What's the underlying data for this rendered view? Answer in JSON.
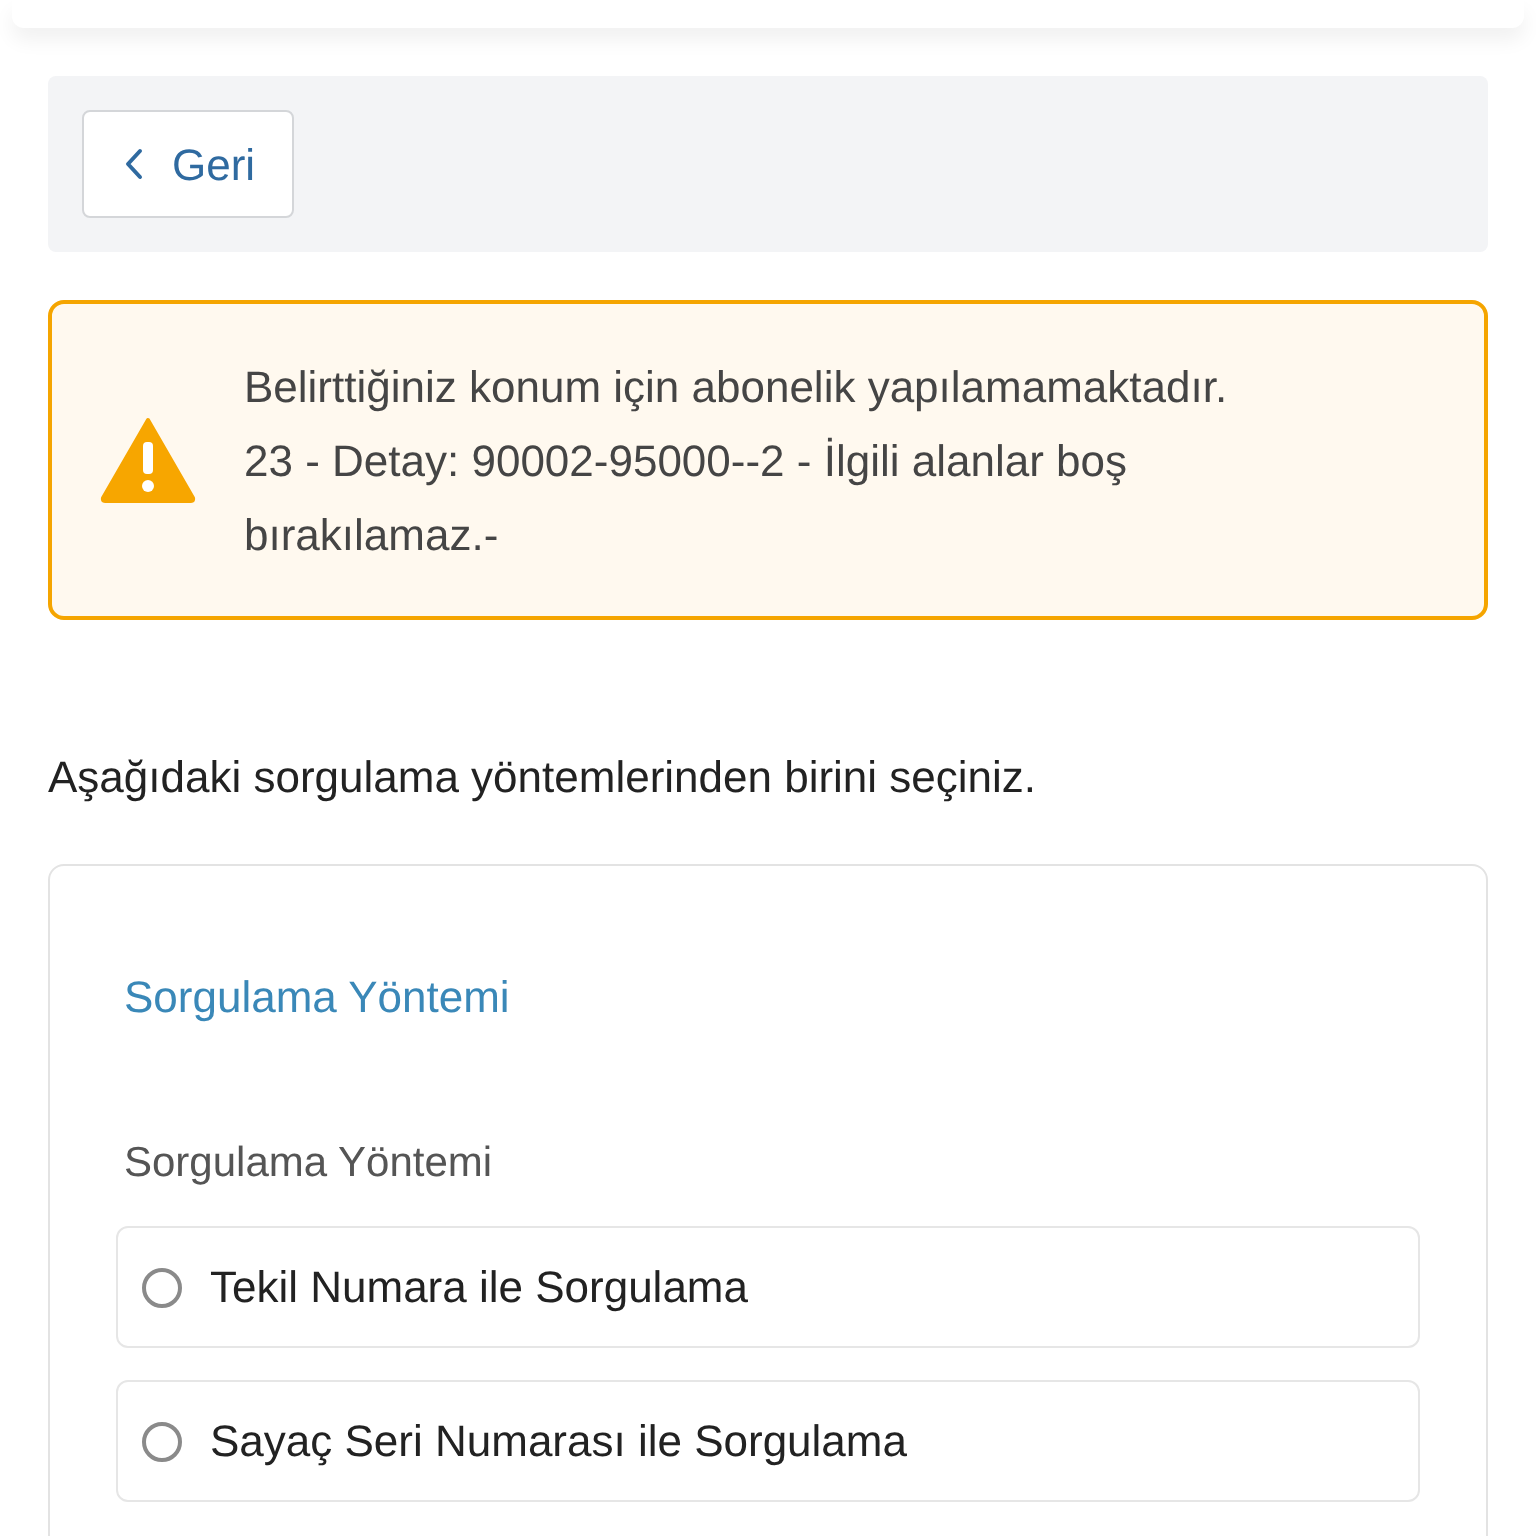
{
  "back_button": {
    "label": "Geri"
  },
  "alert": {
    "kind": "warning",
    "message": "Belirttiğiniz konum için abonelik yapılamamaktadır.",
    "detail": "23 - Detay: 90002-95000--2 - İlgili alanlar boş bırakılamaz.-"
  },
  "instruction": "Aşağıdaki sorgulama yöntemlerinden birini seçiniz.",
  "card": {
    "title": "Sorgulama Yöntemi",
    "field_label": "Sorgulama Yöntemi",
    "options": [
      {
        "label": "Tekil Numara ile Sorgulama",
        "selected": false
      },
      {
        "label": "Sayaç Seri Numarası ile Sorgulama",
        "selected": false
      }
    ]
  }
}
